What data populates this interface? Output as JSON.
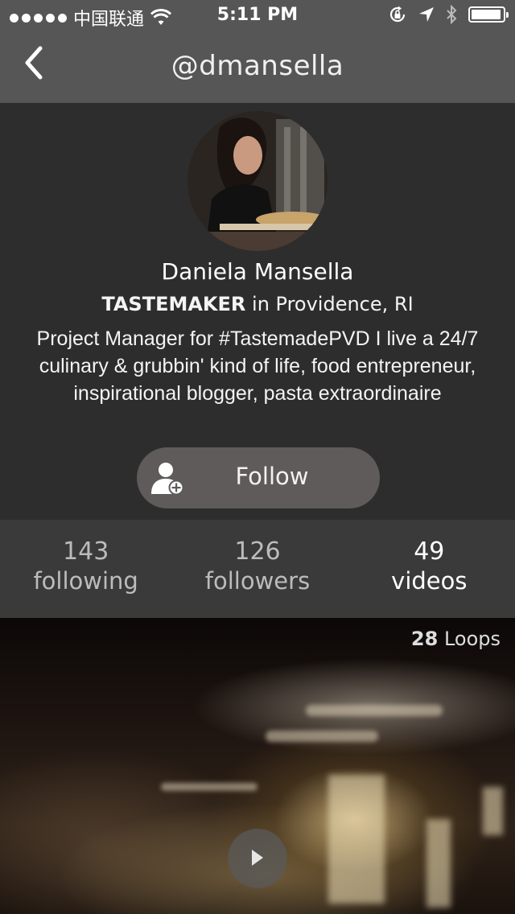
{
  "status_bar": {
    "carrier": "中国联通",
    "time": "5:11 PM",
    "battery_level": 0.95,
    "icons": [
      "signal-dots-icon",
      "wifi-icon",
      "orientation-lock-icon",
      "location-arrow-icon",
      "bluetooth-icon",
      "battery-icon"
    ]
  },
  "nav": {
    "title": "@dmansella",
    "back_icon": "chevron-left-icon"
  },
  "profile": {
    "name": "Daniela Mansella",
    "role_badge": "TASTEMAKER",
    "location": " in Providence, RI",
    "bio": "Project Manager for #TastemadePVD I live a 24/7 culinary & grubbin' kind of life, food entrepreneur, inspirational blogger, pasta extraordinaire",
    "follow_label": "Follow",
    "follow_icon": "add-user-icon"
  },
  "stats": [
    {
      "value": "143",
      "label": "following",
      "active": false
    },
    {
      "value": "126",
      "label": "followers",
      "active": false
    },
    {
      "value": "49",
      "label": "videos",
      "active": true
    }
  ],
  "video": {
    "loops_count": "28",
    "loops_label": " Loops",
    "play_icon": "play-icon"
  },
  "colors": {
    "nav_background": "#575656",
    "profile_background": "#2e2d2d",
    "stats_background": "#3b3a3a",
    "follow_button": "#5e5b5a"
  }
}
